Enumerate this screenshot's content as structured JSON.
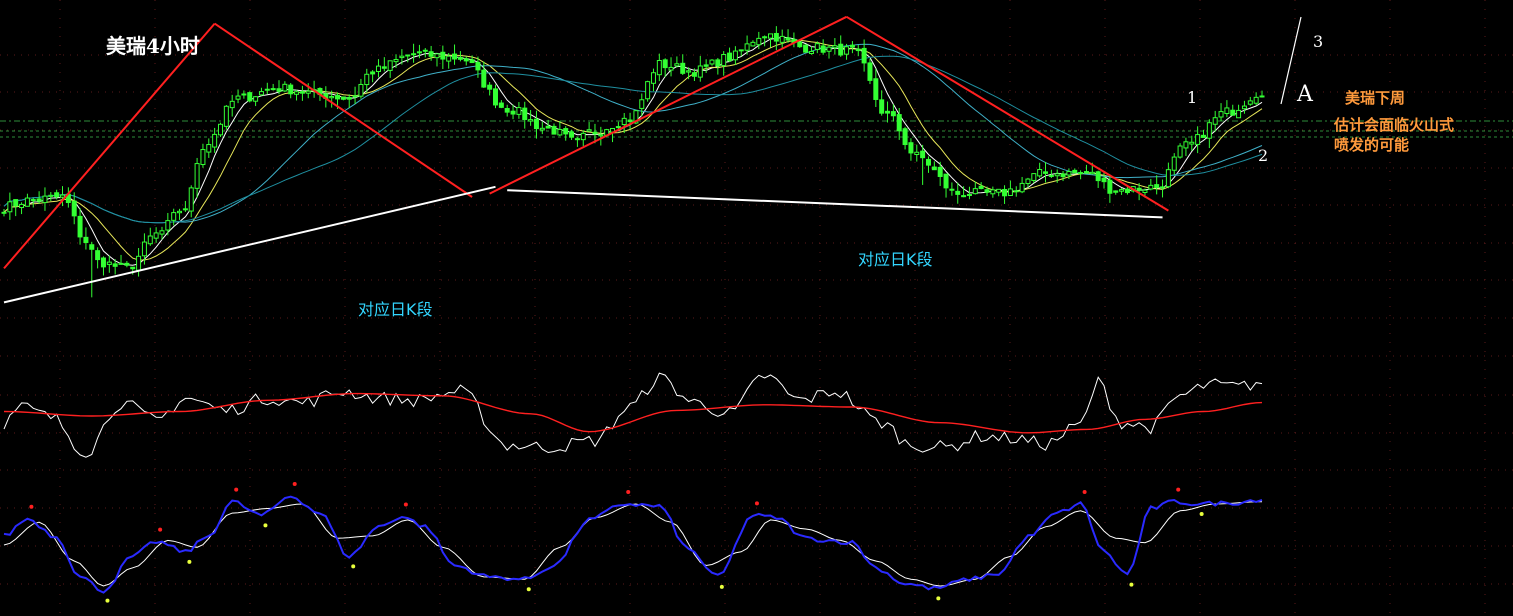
{
  "title": "美瑞4小时",
  "annotations": {
    "segment_label_left": "对应日K段",
    "segment_label_right": "对应日K段",
    "wave_1": "1",
    "wave_2": "2",
    "wave_3": "3",
    "wave_A": "A",
    "note_line1": "美瑞下周",
    "note_line2": "估计会面临火山式",
    "note_line3": "喷发的可能"
  },
  "colors": {
    "background": "#000000",
    "candle_up": "#33ff33",
    "candle_down": "#33ff33",
    "ma_short": "#ffffff",
    "ma_mid": "#e8e85a",
    "ma_long1": "#3fb0c8",
    "ma_long2": "#1f8fa0",
    "trend_red": "#ff2020",
    "trend_white": "#ffffff",
    "indicator_fast": "#ffffff",
    "indicator_slow": "#ff2020",
    "kdj_k": "#2a2aff",
    "kdj_d": "#ffffff",
    "dot_top": "#ff2020",
    "dot_bottom": "#e8ff3c",
    "dashed_level": "#2e8b3a",
    "grid": "#5a1a1a",
    "label_cyan": "#33d6ff",
    "label_orange": "#ff9a3c"
  },
  "chart_data": [
    {
      "type": "candlestick",
      "title": "美瑞4小时",
      "ylim": [
        0,
        100
      ],
      "anchors_close": [
        [
          0,
          42
        ],
        [
          4,
          44
        ],
        [
          10,
          45
        ],
        [
          14,
          32
        ],
        [
          16,
          26
        ],
        [
          21,
          24
        ],
        [
          26,
          34
        ],
        [
          31,
          42
        ],
        [
          34,
          60
        ],
        [
          40,
          74
        ],
        [
          47,
          77
        ],
        [
          55,
          75
        ],
        [
          59,
          74
        ],
        [
          63,
          82
        ],
        [
          70,
          87
        ],
        [
          78,
          86
        ],
        [
          86,
          71
        ],
        [
          93,
          65
        ],
        [
          98,
          61
        ],
        [
          100,
          64
        ],
        [
          107,
          68
        ],
        [
          112,
          84
        ],
        [
          118,
          82
        ],
        [
          124,
          86
        ],
        [
          130,
          93
        ],
        [
          137,
          89
        ],
        [
          145,
          88
        ],
        [
          151,
          69
        ],
        [
          156,
          57
        ],
        [
          163,
          46
        ],
        [
          170,
          46
        ],
        [
          178,
          52
        ],
        [
          185,
          52
        ],
        [
          190,
          47
        ],
        [
          197,
          48
        ],
        [
          202,
          60
        ],
        [
          209,
          70
        ],
        [
          215,
          76
        ]
      ],
      "trend_lines_red": [
        [
          [
            0,
            24
          ],
          [
            36,
            96
          ]
        ],
        [
          [
            36,
            96
          ],
          [
            80,
            45
          ]
        ],
        [
          [
            83,
            46
          ],
          [
            144,
            98
          ]
        ],
        [
          [
            144,
            98
          ],
          [
            199,
            41
          ]
        ]
      ],
      "trend_lines_white": [
        [
          [
            0,
            14
          ],
          [
            84,
            48
          ]
        ],
        [
          [
            86,
            47
          ],
          [
            198,
            39
          ]
        ]
      ]
    },
    {
      "type": "line",
      "ylim": [
        0,
        100
      ],
      "series": [
        {
          "role": "fast",
          "anchors": [
            [
              0,
              44
            ],
            [
              3,
              58
            ],
            [
              8,
              49
            ],
            [
              14,
              18
            ],
            [
              20,
              62
            ],
            [
              26,
              46
            ],
            [
              31,
              66
            ],
            [
              38,
              55
            ],
            [
              45,
              66
            ],
            [
              51,
              62
            ],
            [
              58,
              72
            ],
            [
              64,
              66
            ],
            [
              70,
              64
            ],
            [
              78,
              72
            ],
            [
              86,
              24
            ],
            [
              93,
              22
            ],
            [
              101,
              28
            ],
            [
              107,
              58
            ],
            [
              112,
              84
            ],
            [
              118,
              62
            ],
            [
              124,
              52
            ],
            [
              130,
              86
            ],
            [
              136,
              64
            ],
            [
              142,
              72
            ],
            [
              150,
              44
            ],
            [
              155,
              24
            ],
            [
              161,
              22
            ],
            [
              167,
              32
            ],
            [
              172,
              30
            ],
            [
              178,
              25
            ],
            [
              184,
              42
            ],
            [
              187,
              80
            ],
            [
              191,
              44
            ],
            [
              196,
              40
            ],
            [
              201,
              68
            ],
            [
              206,
              78
            ],
            [
              211,
              76
            ],
            [
              215,
              80
            ]
          ]
        },
        {
          "role": "slow",
          "anchors": [
            [
              0,
              54
            ],
            [
              15,
              50
            ],
            [
              30,
              54
            ],
            [
              45,
              64
            ],
            [
              60,
              70
            ],
            [
              75,
              68
            ],
            [
              90,
              52
            ],
            [
              100,
              36
            ],
            [
              115,
              55
            ],
            [
              130,
              60
            ],
            [
              145,
              58
            ],
            [
              160,
              44
            ],
            [
              175,
              35
            ],
            [
              185,
              38
            ],
            [
              195,
              47
            ],
            [
              205,
              54
            ],
            [
              215,
              62
            ]
          ]
        }
      ]
    },
    {
      "type": "line",
      "ylim": [
        0,
        100
      ],
      "series": [
        {
          "role": "K",
          "anchors": [
            [
              0,
              58
            ],
            [
              4,
              73
            ],
            [
              9,
              57
            ],
            [
              13,
              22
            ],
            [
              17,
              10
            ],
            [
              22,
              40
            ],
            [
              26,
              53
            ],
            [
              31,
              44
            ],
            [
              35,
              58
            ],
            [
              39,
              88
            ],
            [
              44,
              76
            ],
            [
              49,
              93
            ],
            [
              54,
              78
            ],
            [
              59,
              40
            ],
            [
              64,
              66
            ],
            [
              68,
              75
            ],
            [
              72,
              66
            ],
            [
              77,
              32
            ],
            [
              83,
              22
            ],
            [
              89,
              20
            ],
            [
              94,
              32
            ],
            [
              100,
              72
            ],
            [
              106,
              86
            ],
            [
              112,
              84
            ],
            [
              117,
              46
            ],
            [
              122,
              22
            ],
            [
              128,
              76
            ],
            [
              132,
              74
            ],
            [
              137,
              56
            ],
            [
              141,
              54
            ],
            [
              145,
              52
            ],
            [
              149,
              30
            ],
            [
              154,
              16
            ],
            [
              159,
              12
            ],
            [
              165,
              20
            ],
            [
              170,
              25
            ],
            [
              175,
              57
            ],
            [
              180,
              78
            ],
            [
              184,
              86
            ],
            [
              188,
              44
            ],
            [
              192,
              24
            ],
            [
              196,
              82
            ],
            [
              200,
              88
            ],
            [
              204,
              86
            ],
            [
              210,
              87
            ],
            [
              215,
              90
            ]
          ]
        },
        {
          "role": "D",
          "anchors": [
            [
              0,
              50
            ],
            [
              6,
              70
            ],
            [
              12,
              36
            ],
            [
              17,
              14
            ],
            [
              22,
              30
            ],
            [
              28,
              54
            ],
            [
              33,
              48
            ],
            [
              39,
              78
            ],
            [
              45,
              82
            ],
            [
              51,
              86
            ],
            [
              57,
              56
            ],
            [
              63,
              58
            ],
            [
              69,
              72
            ],
            [
              75,
              48
            ],
            [
              82,
              22
            ],
            [
              89,
              20
            ],
            [
              95,
              48
            ],
            [
              101,
              74
            ],
            [
              108,
              86
            ],
            [
              114,
              70
            ],
            [
              120,
              32
            ],
            [
              126,
              44
            ],
            [
              131,
              72
            ],
            [
              137,
              64
            ],
            [
              143,
              54
            ],
            [
              149,
              36
            ],
            [
              155,
              20
            ],
            [
              160,
              14
            ],
            [
              166,
              20
            ],
            [
              172,
              40
            ],
            [
              178,
              66
            ],
            [
              184,
              80
            ],
            [
              190,
              56
            ],
            [
              195,
              52
            ],
            [
              201,
              80
            ],
            [
              207,
              86
            ],
            [
              215,
              88
            ]
          ]
        }
      ]
    }
  ]
}
